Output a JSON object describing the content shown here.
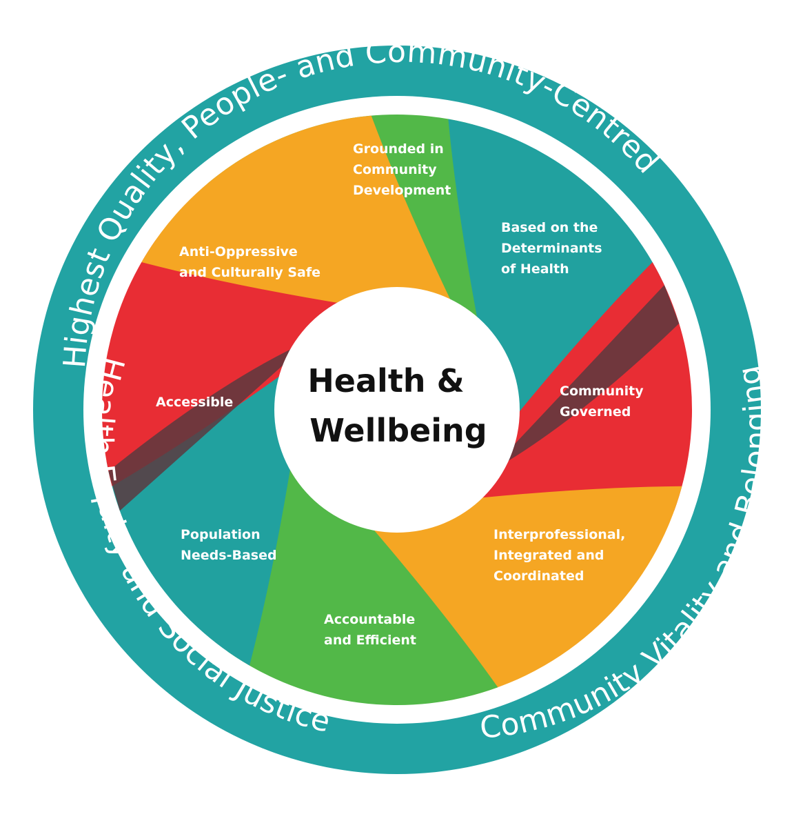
{
  "colors": {
    "ring": "#22a3a3",
    "teal": "#21a19f",
    "green": "#52b848",
    "orange": "#f5a623",
    "red": "#e82d34",
    "shadow": "#5b3a3f"
  },
  "center": {
    "line1": "Health &",
    "line2": "Wellbeing"
  },
  "ring": {
    "top": "Highest Quality, People- and Community-Centred",
    "left": "Health Equity and Social Justice",
    "right": "Community Vitality and Belonging"
  },
  "petals": [
    {
      "lines": [
        "Grounded in",
        "Community",
        "Development"
      ],
      "color": "green"
    },
    {
      "lines": [
        "Based on the",
        "Determinants",
        "of Health"
      ],
      "color": "teal"
    },
    {
      "lines": [
        "Community",
        "Governed"
      ],
      "color": "red"
    },
    {
      "lines": [
        "Interprofessional,",
        "Integrated and",
        "Coordinated"
      ],
      "color": "orange"
    },
    {
      "lines": [
        "Accountable",
        "and Efficient"
      ],
      "color": "green"
    },
    {
      "lines": [
        "Population",
        "Needs-Based"
      ],
      "color": "teal"
    },
    {
      "lines": [
        "Accessible"
      ],
      "color": "red"
    },
    {
      "lines": [
        "Anti-Oppressive",
        "and Culturally Safe"
      ],
      "color": "orange"
    }
  ]
}
